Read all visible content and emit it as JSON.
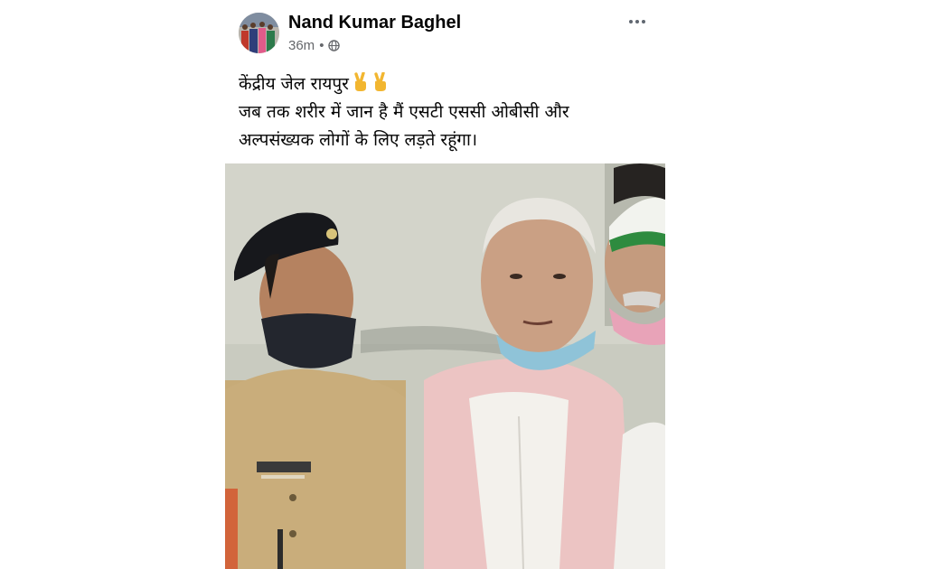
{
  "post": {
    "author_name": "Nand Kumar Baghel",
    "timestamp": "36m",
    "separator": "•",
    "privacy_icon": "globe-icon",
    "more_icon": "more-options-icon",
    "text_lines": [
      "केंद्रीय जेल रायपुर",
      "जब तक शरीर में जान है मैं एसटी एससी ओबीसी और",
      "अल्पसंख्यक लोगों के लिए लड़ते रहूंगा।"
    ],
    "emoji": "victory-hand-icon",
    "photo": "post-photo-image",
    "colors": {
      "name": "#050505",
      "meta": "#65676b",
      "emoji": "#f2b630"
    }
  }
}
